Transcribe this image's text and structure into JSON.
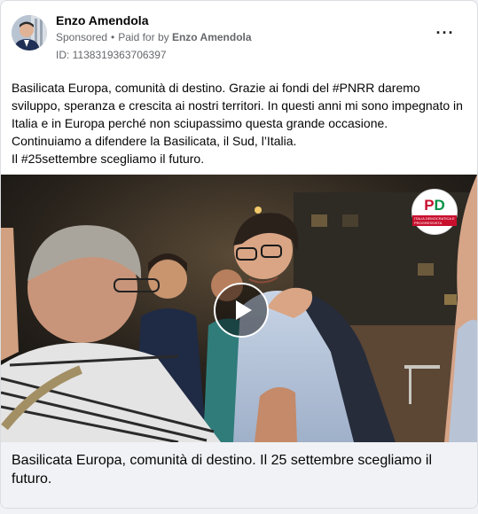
{
  "post": {
    "advertiser_name": "Enzo Amendola",
    "sponsored_label": "Sponsored",
    "separator": "•",
    "paid_for_prefix": "Paid for by",
    "paid_for_name": "Enzo Amendola",
    "ad_id": "ID: 1138319363706397",
    "more_glyph": "···"
  },
  "body": {
    "lines": [
      "Basilicata Europa, comunità di destino. Grazie ai fondi del #PNRR daremo sviluppo, speranza e crescita ai nostri territori. In questi anni mi sono impegnato in Italia e in Europa perché non sciupassimo questa grande occasione.",
      "Continuiamo a difendere la Basilicata, il Sud, l’Italia.",
      "Il #25settembre scegliamo il futuro."
    ]
  },
  "media": {
    "logo_letters_p": "P",
    "logo_letters_d": "D",
    "logo_subtext": "ITALIA DEMOCRATICA E PROGRESSISTA",
    "play_icon": "play-icon"
  },
  "caption": {
    "title": "Basilicata Europa, comunità di destino. Il 25 settembre scegliamo il futuro."
  },
  "colors": {
    "name_text": "#050505",
    "meta_text": "#65676b",
    "card_border": "#dadde1",
    "caption_bg": "#f0f2f5",
    "pd_red": "#c8102e",
    "pd_green": "#009246"
  }
}
